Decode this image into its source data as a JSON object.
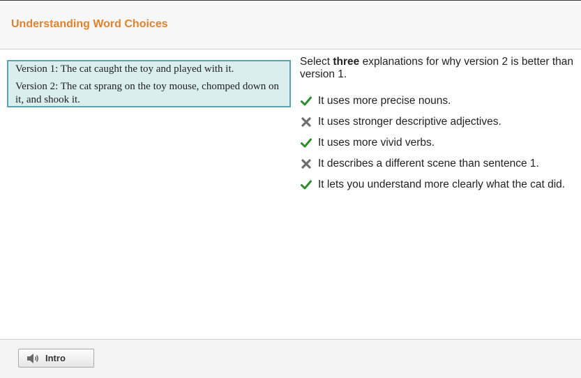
{
  "header": {
    "title": "Understanding Word Choices"
  },
  "passage": {
    "version1": "Version 1: The cat caught the toy and played with it.",
    "version2": "Version 2: The cat sprang on the toy mouse, chomped down on it, and shook it."
  },
  "question": {
    "prefix": "Select ",
    "emphasis": "three",
    "suffix": " explanations for why version 2 is better than version 1."
  },
  "options": [
    {
      "text": "It uses more precise nouns.",
      "status": "correct",
      "icon": "check-icon"
    },
    {
      "text": "It uses stronger descriptive adjectives.",
      "status": "incorrect",
      "icon": "x-icon"
    },
    {
      "text": "It uses more vivid verbs.",
      "status": "correct",
      "icon": "check-icon"
    },
    {
      "text": "It describes a different scene than sentence 1.",
      "status": "incorrect",
      "icon": "x-icon"
    },
    {
      "text": "It lets you understand more clearly what the cat did.",
      "status": "correct",
      "icon": "check-icon"
    }
  ],
  "footer": {
    "intro_label": "Intro",
    "intro_icon": "speaker-icon"
  },
  "colors": {
    "title": "#e0822d",
    "check": "#2e8b2e",
    "cross": "#6f6f6f",
    "passage_bg": "#daeef0",
    "passage_border": "#5aa3ac"
  }
}
